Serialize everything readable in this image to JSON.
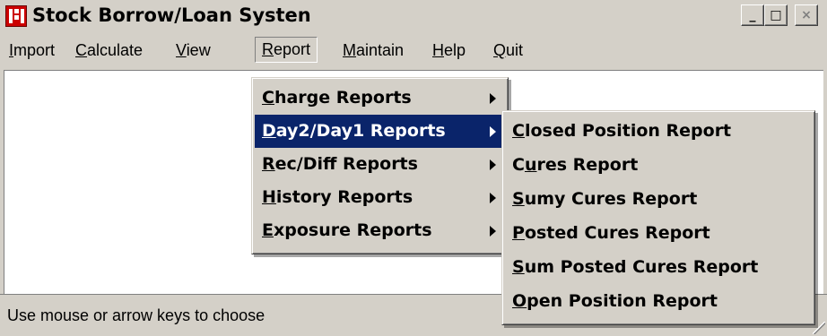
{
  "window": {
    "title": "Stock Borrow/Loan Systen"
  },
  "title_buttons": {
    "minimize": "_",
    "maximize": "□",
    "close": "×"
  },
  "menubar": [
    {
      "label": "Import",
      "mn": "I",
      "rest": "mport"
    },
    {
      "label": "Calculate",
      "mn": "C",
      "rest": "alculate"
    },
    {
      "label": "View",
      "mn": "V",
      "rest": "iew"
    },
    {
      "label": "Report",
      "mn": "R",
      "rest": "eport"
    },
    {
      "label": "Maintain",
      "mn": "M",
      "rest": "aintain"
    },
    {
      "label": "Help",
      "mn": "H",
      "rest": "elp"
    },
    {
      "label": "Quit",
      "mn": "Q",
      "rest": "uit"
    }
  ],
  "report_menu": [
    {
      "mn": "C",
      "rest": "harge Reports"
    },
    {
      "mn": "D",
      "rest": "ay2/Day1 Reports"
    },
    {
      "mn": "R",
      "rest": "ec/Diff Reports"
    },
    {
      "mn": "H",
      "rest": "istory Reports"
    },
    {
      "mn": "E",
      "rest": "xposure Reports"
    }
  ],
  "day_submenu": [
    {
      "mn": "C",
      "rest": "losed Position Report"
    },
    {
      "pre": "C",
      "mn": "u",
      "rest": "res Report"
    },
    {
      "mn": "S",
      "rest": "umy Cures Report"
    },
    {
      "mn": "P",
      "rest": "osted Cures Report"
    },
    {
      "mn": "S",
      "rest": "um Posted Cures Report"
    },
    {
      "mn": "O",
      "rest": "pen Position Report"
    }
  ],
  "status": {
    "text": "Use mouse or arrow keys to choose"
  },
  "colors": {
    "highlight": "#0a246a",
    "face": "#d4d0c8"
  }
}
